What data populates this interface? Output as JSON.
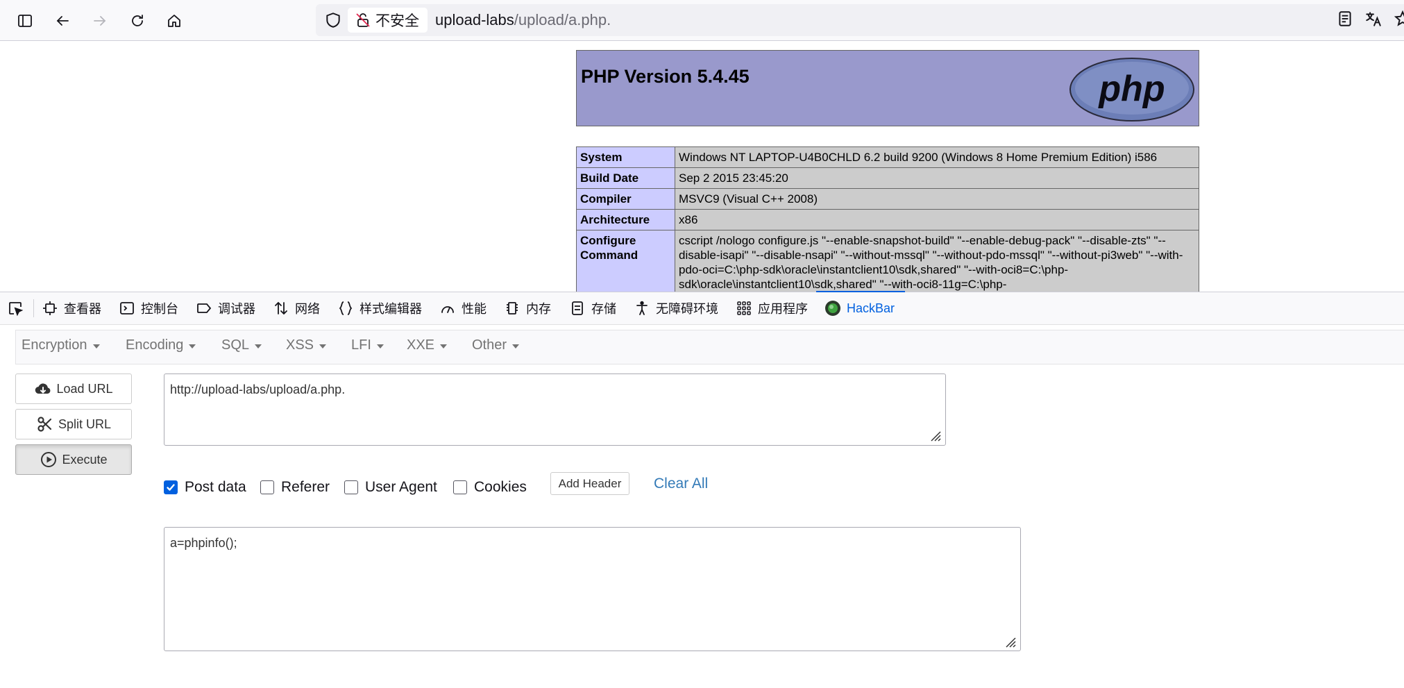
{
  "browser": {
    "not_secure_label": "不安全",
    "url_host": "upload-labs",
    "url_path": "/upload/a.php."
  },
  "phpinfo": {
    "title": "PHP Version 5.4.45",
    "rows": [
      {
        "key": "System",
        "value": "Windows NT LAPTOP-U4B0CHLD 6.2 build 9200 (Windows 8 Home Premium Edition) i586"
      },
      {
        "key": "Build Date",
        "value": "Sep 2 2015 23:45:20"
      },
      {
        "key": "Compiler",
        "value": "MSVC9 (Visual C++ 2008)"
      },
      {
        "key": "Architecture",
        "value": "x86"
      },
      {
        "key": "Configure Command",
        "value": "cscript /nologo configure.js \"--enable-snapshot-build\" \"--enable-debug-pack\" \"--disable-zts\" \"--disable-isapi\" \"--disable-nsapi\" \"--without-mssql\" \"--without-pdo-mssql\" \"--without-pi3web\" \"--with-pdo-oci=C:\\php-sdk\\oracle\\instantclient10\\sdk,shared\" \"--with-oci8=C:\\php-sdk\\oracle\\instantclient10\\sdk,shared\" \"--with-oci8-11g=C:\\php-"
      }
    ]
  },
  "devtools": {
    "tabs": [
      {
        "label": "查看器",
        "icon": "inspector-icon"
      },
      {
        "label": "控制台",
        "icon": "console-icon"
      },
      {
        "label": "调试器",
        "icon": "debugger-icon"
      },
      {
        "label": "网络",
        "icon": "network-icon"
      },
      {
        "label": "样式编辑器",
        "icon": "style-editor-icon"
      },
      {
        "label": "性能",
        "icon": "performance-icon"
      },
      {
        "label": "内存",
        "icon": "memory-icon"
      },
      {
        "label": "存储",
        "icon": "storage-icon"
      },
      {
        "label": "无障碍环境",
        "icon": "accessibility-icon"
      },
      {
        "label": "应用程序",
        "icon": "application-icon"
      },
      {
        "label": "HackBar",
        "icon": "hackbar-icon"
      }
    ],
    "active_tab": "HackBar"
  },
  "hackbar": {
    "menu": [
      "Encryption",
      "Encoding",
      "SQL",
      "XSS",
      "LFI",
      "XXE",
      "Other"
    ],
    "buttons": {
      "load_url": "Load URL",
      "split_url": "Split URL",
      "execute": "Execute"
    },
    "url_value": "http://upload-labs/upload/a.php.",
    "options": {
      "post_data": {
        "label": "Post data",
        "checked": true
      },
      "referer": {
        "label": "Referer",
        "checked": false
      },
      "user_agent": {
        "label": "User Agent",
        "checked": false
      },
      "cookies": {
        "label": "Cookies",
        "checked": false
      }
    },
    "add_header_label": "Add Header",
    "clear_all_label": "Clear All",
    "post_body": "a=phpinfo();",
    "colors": {
      "accent": "#0060df",
      "link": "#337ab7"
    }
  }
}
